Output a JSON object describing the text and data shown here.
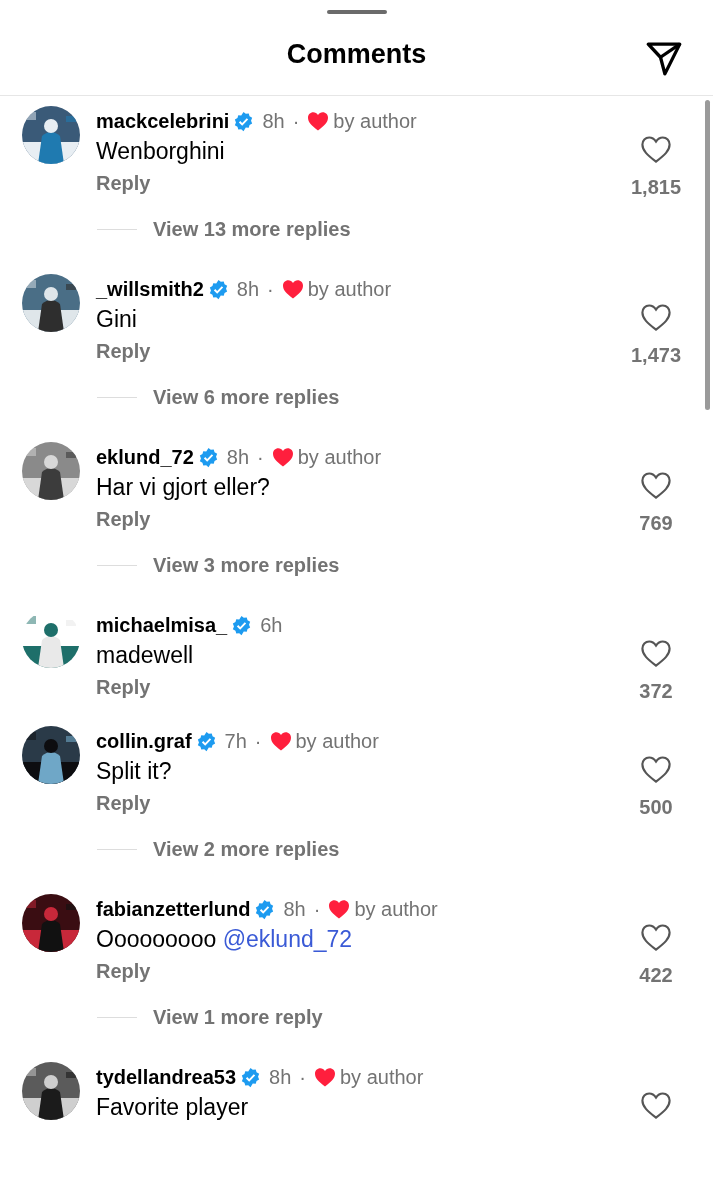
{
  "header": {
    "title": "Comments"
  },
  "comments": [
    {
      "username": "mackcelebrini",
      "verified": true,
      "time": "8h",
      "liked_by_author": true,
      "separator": "·",
      "author_label": "by author",
      "text": "Wenborghini",
      "reply": "Reply",
      "likes": "1,815",
      "view_replies": "View 13 more replies"
    },
    {
      "username": "_willsmith2",
      "verified": true,
      "time": "8h",
      "liked_by_author": true,
      "separator": "·",
      "author_label": "by author",
      "text": "Gini",
      "reply": "Reply",
      "likes": "1,473",
      "view_replies": "View 6 more replies"
    },
    {
      "username": "eklund_72",
      "verified": true,
      "time": "8h",
      "liked_by_author": true,
      "separator": "·",
      "author_label": "by author",
      "text": "Har vi gjort eller?",
      "reply": "Reply",
      "likes": "769",
      "view_replies": "View 3 more replies"
    },
    {
      "username": "michaelmisa_",
      "verified": true,
      "time": "6h",
      "liked_by_author": false,
      "text": "madewell",
      "reply": "Reply",
      "likes": "372"
    },
    {
      "username": "collin.graf",
      "verified": true,
      "time": "7h",
      "liked_by_author": true,
      "separator": "·",
      "author_label": "by author",
      "text": "Split it?",
      "reply": "Reply",
      "likes": "500",
      "view_replies": "View 2 more replies"
    },
    {
      "username": "fabianzetterlund",
      "verified": true,
      "time": "8h",
      "liked_by_author": true,
      "separator": "·",
      "author_label": "by author",
      "text": "Ooooooooo",
      "mention": "@eklund_72",
      "reply": "Reply",
      "likes": "422",
      "view_replies": "View 1 more reply"
    },
    {
      "username": "tydellandrea53",
      "verified": true,
      "time": "8h",
      "liked_by_author": true,
      "separator": "·",
      "author_label": "by author",
      "text": "Favorite player"
    }
  ]
}
